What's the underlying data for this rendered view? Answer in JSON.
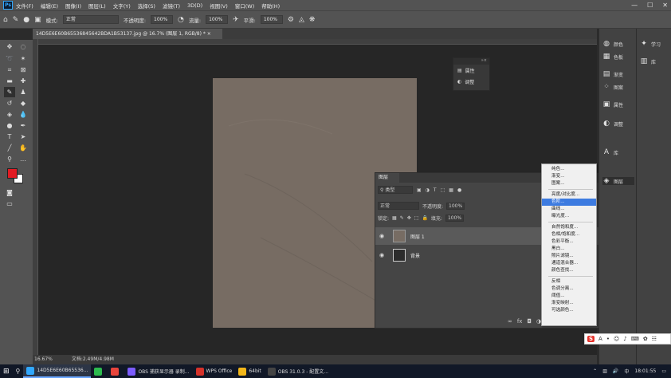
{
  "menubar": {
    "logo": "Ps",
    "items": [
      "文件(F)",
      "编辑(E)",
      "图像(I)",
      "图层(L)",
      "文字(Y)",
      "选择(S)",
      "滤镜(T)",
      "3D(D)",
      "视图(V)",
      "窗口(W)",
      "帮助(H)"
    ],
    "window_controls": [
      "—",
      "☐",
      "✕"
    ]
  },
  "options": {
    "mode_label": "模式:",
    "mode_value": "正常",
    "opacity_label": "不透明度:",
    "opacity_value": "100%",
    "flow_label": "流量:",
    "flow_value": "100%",
    "smooth_label": "平滑:",
    "smooth_value": "100%"
  },
  "document": {
    "tab_title": "14D5E6E60B65536845642BDA1B53137.jpg @ 16.7% (图层 1, RGB/8) * ×",
    "zoom": "16.67%",
    "doc_size": "文档:2.49M/4.98M"
  },
  "float_panel": {
    "items": [
      "属性",
      "调整"
    ]
  },
  "layers": {
    "tab": "图层",
    "filter_kind": "类型",
    "blend_mode": "正常",
    "opacity_label": "不透明度:",
    "opacity_value": "100%",
    "lock_label": "锁定:",
    "fill_label": "填充:",
    "fill_value": "100%",
    "rows": [
      {
        "name": "图层 1"
      },
      {
        "name": "背景"
      }
    ]
  },
  "context_menu": {
    "groups": [
      [
        "纯色...",
        "渐变...",
        "图案..."
      ],
      [
        "亮度/对比度...",
        "色阶...",
        "曲线...",
        "曝光度..."
      ],
      [
        "自然饱和度...",
        "色相/饱和度...",
        "色彩平衡...",
        "黑白...",
        "照片滤镜...",
        "通道混合器...",
        "颜色查找..."
      ],
      [
        "反相",
        "色调分离...",
        "阈值...",
        "渐变映射...",
        "可选颜色..."
      ]
    ],
    "selected": "色阶..."
  },
  "right_panels": {
    "col1": [
      "颜色",
      "色板",
      "渐变",
      "图案",
      "属性",
      "调整",
      "库",
      "图层"
    ],
    "col2": [
      "学习",
      "库"
    ]
  },
  "taskbar": {
    "apps": [
      {
        "label": "14D5E6E60B65536...",
        "color": "#31a8ff"
      },
      {
        "label": "",
        "color": "#2dbb4e"
      },
      {
        "label": "",
        "color": "#e8453c"
      },
      {
        "label": "OBS 捕获显示器 录制...",
        "color": "#7c5cff"
      },
      {
        "label": "WPS Office",
        "color": "#d6322a"
      },
      {
        "label": "64bit",
        "color": "#f2b619"
      },
      {
        "label": "OBS 31.0.3 - 配置文...",
        "color": "#444444"
      }
    ],
    "time": "18:01:55"
  },
  "colors": {
    "foreground": "#e21b23",
    "background": "#ffffff",
    "canvas": "#776c63",
    "selection": "#3d7be0"
  }
}
